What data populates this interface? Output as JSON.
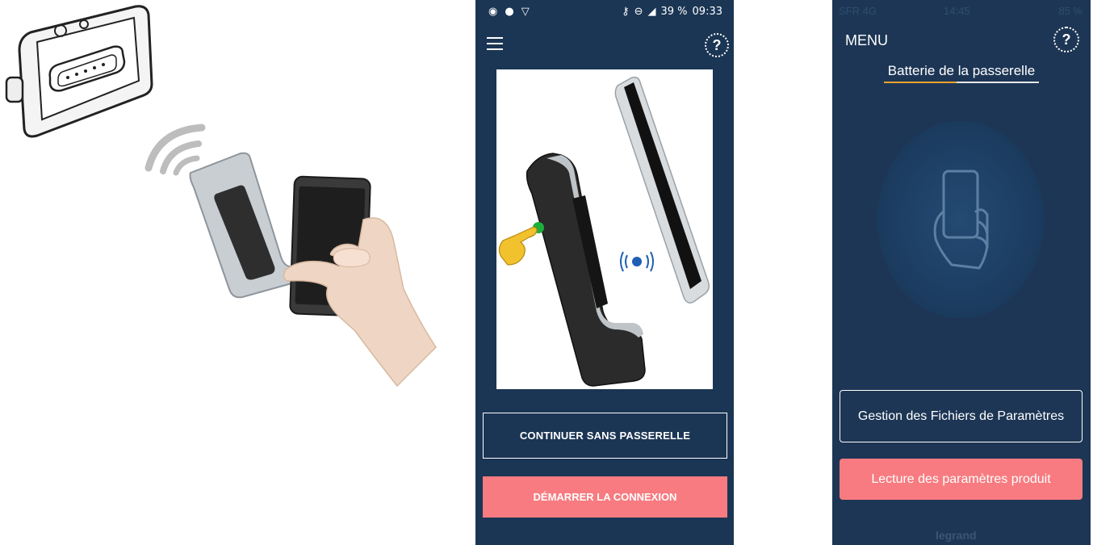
{
  "phone1": {
    "status": {
      "icons_left": [
        "wifi-hotspot-icon",
        "app-icon",
        "shield-icon"
      ],
      "icons_right": [
        "key-icon",
        "dnd-icon",
        "signal-icon"
      ],
      "battery": "39 %",
      "time": "09:33"
    },
    "help_label": "?",
    "continue_button": "CONTINUER SANS PASSERELLE",
    "connect_button": "DÉMARRER LA CONNEXION"
  },
  "phone2": {
    "status": {
      "carrier": "SFR 4G",
      "time": "14:45",
      "battery": "85 %"
    },
    "menu_label": "MENU",
    "help_label": "?",
    "tab_title": "Batterie de la passerelle",
    "files_button": "Gestion des Fichiers de Paramètres",
    "read_button": "Lecture des paramètres produit",
    "brand": "legrand"
  },
  "colors": {
    "panel_bg": "#1b3554",
    "accent_pink": "#f77b80",
    "tab_accent": "#f1a42c"
  }
}
